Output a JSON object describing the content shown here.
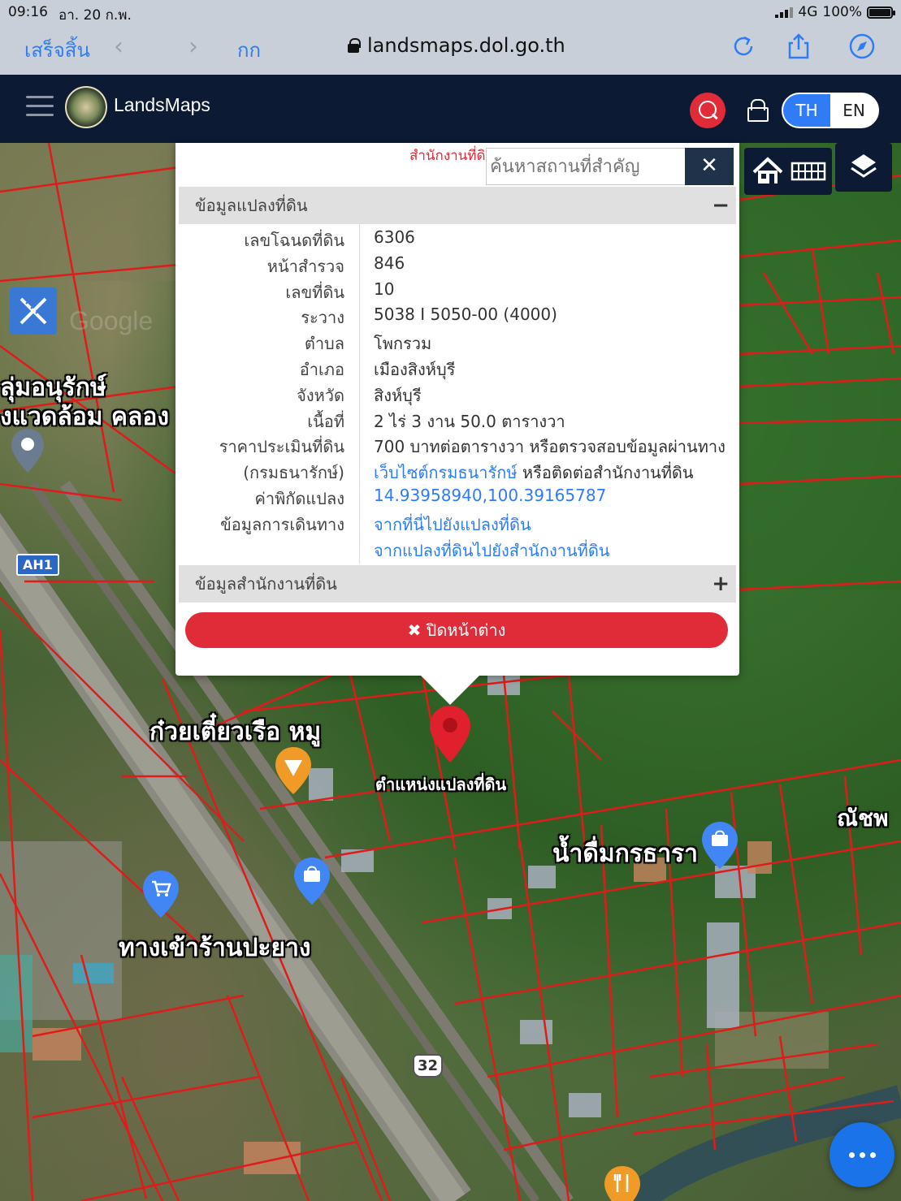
{
  "statusbar": {
    "time": "09:16",
    "date": "อา. 20 ก.พ.",
    "network": "4G",
    "battery": "100%",
    "battery_level": 1.0
  },
  "browser": {
    "done_label": "เสร็จสิ้น",
    "text_size_label": "กก",
    "url": "landsmaps.dol.go.th"
  },
  "app": {
    "brand": "LandsMaps",
    "lang_th": "TH",
    "lang_en": "EN",
    "active_lang": "TH",
    "accent_color": "#2f7cf6",
    "danger_color": "#e02b38",
    "header_color": "#0c1a33"
  },
  "popup": {
    "office_label": "สำนักงานที่ดิน",
    "search_placeholder": "ค้นหาสถานที่สำคัญ",
    "clear_label": "✕",
    "parcel_section_title": "ข้อมูลแปลงที่ดิน",
    "parcel_section_toggle": "−",
    "office_section_title": "ข้อมูลสำนักงานที่ดิน",
    "office_section_toggle": "+",
    "close_label": "✖ ปิดหน้าต่าง",
    "rows": [
      {
        "key": "เลขโฉนดที่ดิน",
        "value": "6306"
      },
      {
        "key": "หน้าสำรวจ",
        "value": "846"
      },
      {
        "key": "เลขที่ดิน",
        "value": "10"
      },
      {
        "key": "ระวาง",
        "value": "5038 I 5050-00 (4000)"
      },
      {
        "key": "ตำบล",
        "value": "โพกรวม"
      },
      {
        "key": "อำเภอ",
        "value": "เมืองสิงห์บุรี"
      },
      {
        "key": "จังหวัด",
        "value": "สิงห์บุรี"
      },
      {
        "key": "เนื้อที่",
        "value": "2 ไร่ 3 งาน 50.0 ตารางวา"
      },
      {
        "key": "ราคาประเมินที่ดิน",
        "value": "700 บาทต่อตารางวา หรือตรวจสอบข้อมูลผ่านทาง"
      },
      {
        "key": "(กรมธนารักษ์)",
        "value_link": "เว็บไซต์กรมธนารักษ์",
        "value_rest": " หรือติดต่อสำนักงานที่ดิน"
      },
      {
        "key": "ค่าพิกัดแปลง",
        "value_link": "14.93958940,100.39165787"
      },
      {
        "key": "ข้อมูลการเดินทาง",
        "value_link": "จากที่นี่ไปยังแปลงที่ดิน"
      },
      {
        "key": "",
        "value_link": "จากแปลงที่ดินไปยังสำนักงานที่ดิน"
      }
    ]
  },
  "map": {
    "labels": {
      "conservation_1": "ลุ่มอนุรักษ์",
      "conservation_2": "งแวดล้อม คลอง",
      "highway": "AH1",
      "noodle_shop": "ก๋วยเตี๋ยวเรือ หมู",
      "parcel_marker": "ตำแหน่งแปลงที่ดิน",
      "drinking_water": "น้ำดื่มกรธารา",
      "entrance": "ทางเข้าร้านปะยาง",
      "right_edge": "ณัชพ",
      "route_shield": "32",
      "watermark": "Google"
    },
    "icons": [
      "home-icon",
      "grid-icon",
      "layers-icon",
      "measure-icon",
      "location-pin-icon",
      "cart-pin-icon",
      "bag-pin-icon",
      "food-pin-icon"
    ],
    "parcel_line_color": "#e01b1b",
    "marker_color": "#e0202c"
  }
}
